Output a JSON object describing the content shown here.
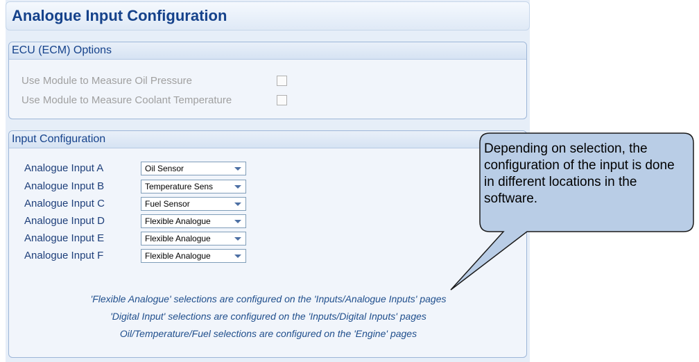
{
  "title": "Analogue Input Configuration",
  "ecu_group": {
    "header": "ECU (ECM) Options",
    "options": [
      {
        "label": "Use Module to Measure Oil Pressure",
        "checked": false
      },
      {
        "label": "Use Module to Measure Coolant Temperature",
        "checked": false
      }
    ]
  },
  "input_group": {
    "header": "Input Configuration",
    "inputs": [
      {
        "label": "Analogue Input A",
        "value": "Oil Sensor"
      },
      {
        "label": "Analogue Input B",
        "value": "Temperature Sens"
      },
      {
        "label": "Analogue Input C",
        "value": "Fuel Sensor"
      },
      {
        "label": "Analogue Input D",
        "value": "Flexible Analogue"
      },
      {
        "label": "Analogue Input E",
        "value": "Flexible Analogue"
      },
      {
        "label": "Analogue Input F",
        "value": "Flexible Analogue"
      }
    ],
    "notes": [
      "'Flexible Analogue' selections are configured on the 'Inputs/Analogue Inputs' pages",
      "'Digital Input' selections are configured on the 'Inputs/Digital Inputs' pages",
      "Oil/Temperature/Fuel selections are configured on the 'Engine' pages"
    ]
  },
  "callout": {
    "text": "Depending on selection, the configuration of the input is done in different locations in the software."
  },
  "colors": {
    "title": "#15428b",
    "label": "#1e3f7a",
    "callout_fill": "#b9cde6",
    "note": "#1f4e8c"
  }
}
